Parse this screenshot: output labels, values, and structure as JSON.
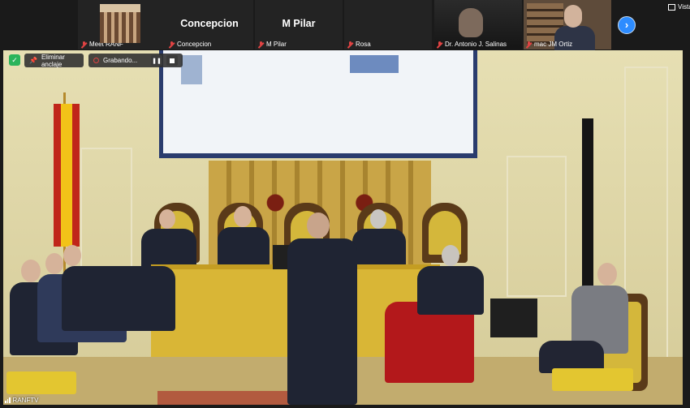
{
  "participants": [
    {
      "id": "p1",
      "label": "Meet RANF"
    },
    {
      "id": "p2",
      "label": "Concepcion",
      "display_name": "Concepcion"
    },
    {
      "id": "p3",
      "label": "M Pilar",
      "display_name": "M Pilar"
    },
    {
      "id": "p4",
      "label": "Rosa"
    },
    {
      "id": "p5",
      "label": "Dr. Antonio J. Salinas"
    },
    {
      "id": "p6",
      "label": "mac JM Ortiz"
    }
  ],
  "view_button": {
    "label": "Vista"
  },
  "next_icon": "chevron-right-icon",
  "recording_bar": {
    "unpin_label": "Eliminar anclaje",
    "recording_label": "Grabando..."
  },
  "speaker_label": "RANFTV",
  "colors": {
    "accent": "#2d8cff",
    "recording": "#e04343",
    "secure": "#2bb45b"
  }
}
